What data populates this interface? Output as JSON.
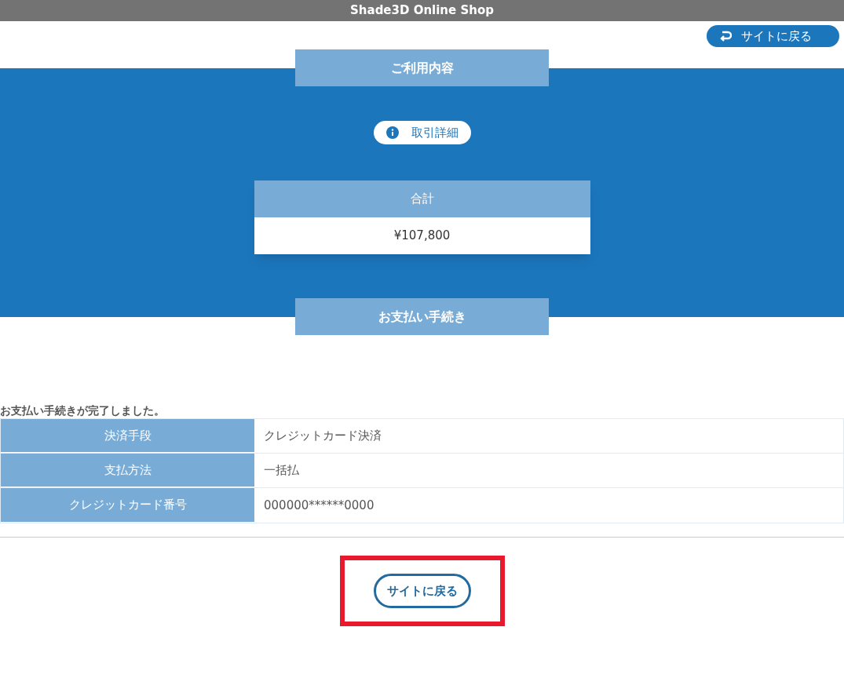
{
  "header": {
    "title": "Shade3D Online Shop"
  },
  "top_link": {
    "label": "サイトに戻る"
  },
  "usage_section": {
    "heading": "ご利用内容",
    "details_button": "取引詳細",
    "total": {
      "label": "合計",
      "value": "¥107,800"
    }
  },
  "payment_section": {
    "heading": "お支払い手続き",
    "message": "お支払い手続きが完了しました。",
    "rows": [
      {
        "label": "決済手段",
        "value": "クレジットカード決済"
      },
      {
        "label": "支払方法",
        "value": "一括払"
      },
      {
        "label": "クレジットカード番号",
        "value": "000000******0000"
      }
    ]
  },
  "back_button": {
    "label": "サイトに戻る"
  }
}
